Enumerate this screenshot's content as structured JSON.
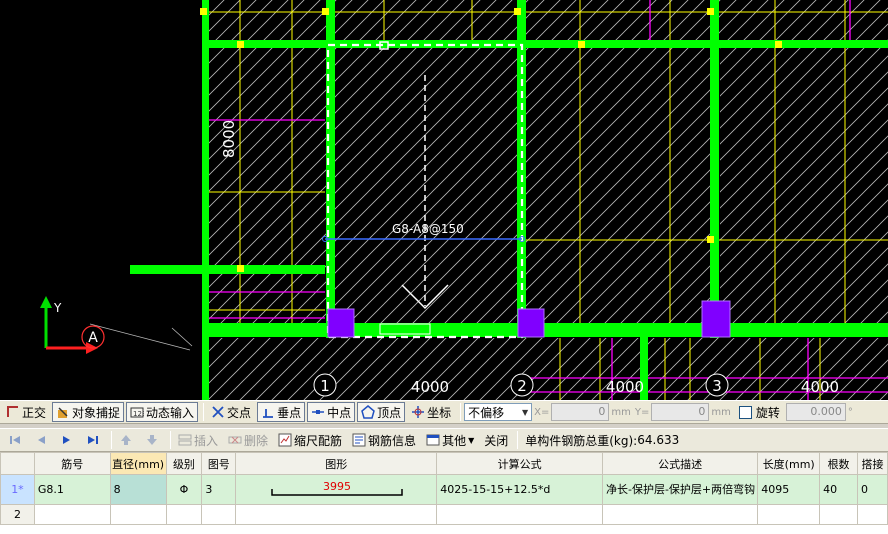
{
  "cad": {
    "dimension_vertical": "8000",
    "rebar_label": "G8-A8@150",
    "axis_labels": [
      "1",
      "2",
      "3"
    ],
    "span_labels": [
      "4000",
      "4000",
      "4000"
    ],
    "ucs": {
      "y": "Y",
      "origin": "A"
    }
  },
  "snap_toolbar": {
    "ortho": "正交",
    "object_snap": "对象捕捉",
    "dynamic_input": "动态输入",
    "intersection": "交点",
    "perpendicular": "垂点",
    "midpoint": "中点",
    "vertex": "顶点",
    "coordinate": "坐标",
    "offset_mode": "不偏移",
    "x_label": "X=",
    "x_value": "0",
    "y_label": "Y=",
    "y_value": "0",
    "unit": "mm",
    "rotate_label": "旋转",
    "rotate_value": "0.000",
    "degree": "°"
  },
  "edit_toolbar": {
    "insert": "插入",
    "delete": "删除",
    "scale_rebar": "缩尺配筋",
    "rebar_info": "钢筋信息",
    "other": "其他",
    "close": "关闭",
    "total_weight_label": "单构件钢筋总重(kg):",
    "total_weight_value": "64.633"
  },
  "table": {
    "columns": [
      "筋号",
      "直径(mm)",
      "级别",
      "图号",
      "图形",
      "计算公式",
      "公式描述",
      "长度(mm)",
      "根数",
      "搭接"
    ],
    "rows": [
      {
        "index": "1*",
        "bar_no": "G8.1",
        "diameter": "8",
        "grade": "Φ",
        "shape_no": "3",
        "shape_length": "3995",
        "formula": "4025-15-15+12.5*d",
        "description": "净长-保护层-保护层+两倍弯钩",
        "length": "4095",
        "count": "40",
        "lap": "0"
      },
      {
        "index": "2"
      }
    ]
  },
  "colors": {
    "cad_bg": "#000000",
    "beam_green": "#00ff00",
    "grid_yellow": "#ffff00",
    "magenta": "#ff00ff",
    "column_purple": "#8000ff",
    "rebar_blue": "#3a6cff"
  }
}
